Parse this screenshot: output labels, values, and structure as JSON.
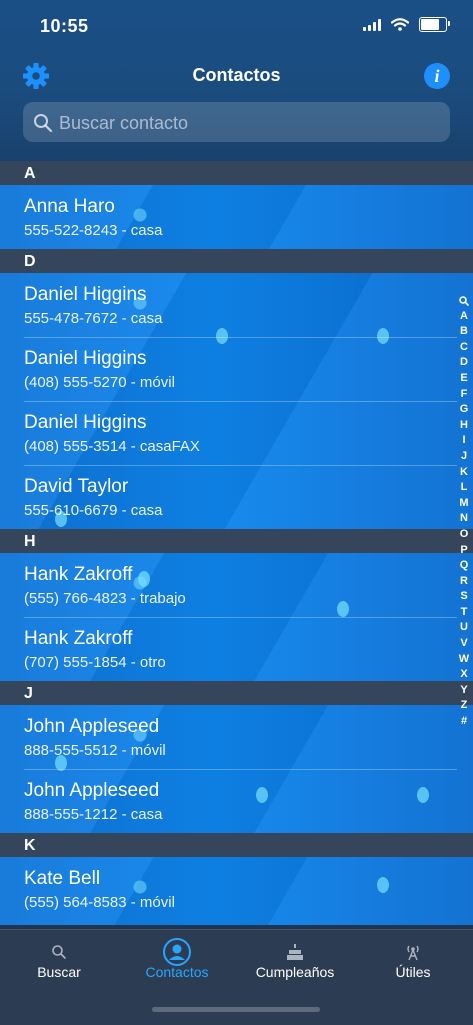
{
  "status_bar": {
    "time": "10:55"
  },
  "nav": {
    "title": "Contactos"
  },
  "search": {
    "placeholder": "Buscar contacto"
  },
  "sections": [
    {
      "letter": "A",
      "rows": [
        {
          "name": "Anna Haro",
          "detail": "555-522-8243 - casa"
        }
      ]
    },
    {
      "letter": "D",
      "rows": [
        {
          "name": "Daniel Higgins",
          "detail": "555-478-7672 - casa"
        },
        {
          "name": "Daniel Higgins",
          "detail": "(408) 555-5270 - móvil"
        },
        {
          "name": "Daniel Higgins",
          "detail": "(408) 555-3514 - casaFAX"
        },
        {
          "name": "David Taylor",
          "detail": "555-610-6679 - casa"
        }
      ]
    },
    {
      "letter": "H",
      "rows": [
        {
          "name": "Hank Zakroff",
          "detail": "(555) 766-4823 - trabajo"
        },
        {
          "name": "Hank Zakroff",
          "detail": "(707) 555-1854 - otro"
        }
      ]
    },
    {
      "letter": "J",
      "rows": [
        {
          "name": "John Appleseed",
          "detail": "888-555-5512 - móvil"
        },
        {
          "name": "John Appleseed",
          "detail": "888-555-1212 - casa"
        }
      ]
    },
    {
      "letter": "K",
      "rows": [
        {
          "name": "Kate Bell",
          "detail": "(555) 564-8583 - móvil"
        }
      ]
    }
  ],
  "index": [
    "A",
    "B",
    "C",
    "D",
    "E",
    "F",
    "G",
    "H",
    "I",
    "J",
    "K",
    "L",
    "M",
    "N",
    "O",
    "P",
    "Q",
    "R",
    "S",
    "T",
    "U",
    "V",
    "W",
    "X",
    "Y",
    "Z",
    "#"
  ],
  "tabs": [
    {
      "label": "Buscar",
      "icon": "search-icon",
      "active": false
    },
    {
      "label": "Contactos",
      "icon": "person-circle-icon",
      "active": true
    },
    {
      "label": "Cumpleaños",
      "icon": "cake-icon",
      "active": false
    },
    {
      "label": "Útiles",
      "icon": "antenna-icon",
      "active": false
    }
  ],
  "colors": {
    "accent": "#2aa5ff",
    "info": "#1e8fff",
    "section_header": "#35455c",
    "row_blue": "#0f86ee",
    "tab_bar": "#2c3c53"
  }
}
